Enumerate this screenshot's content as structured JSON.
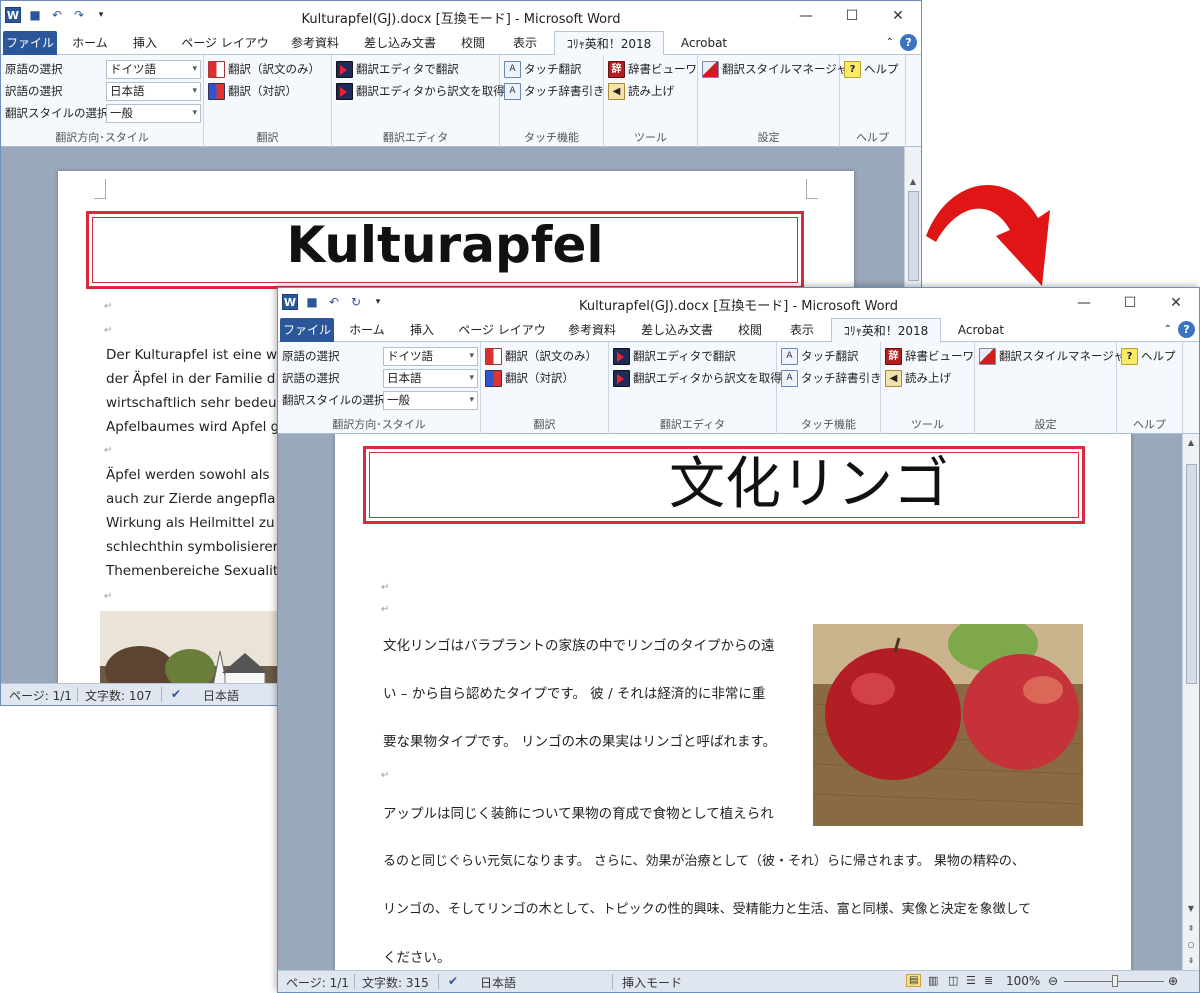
{
  "window_back": {
    "title": "Kulturapfel(GJ).docx [互換モード] - Microsoft Word",
    "tabs": [
      "ファイル",
      "ホーム",
      "挿入",
      "ページ レイアウト",
      "参考資料",
      "差し込み文書",
      "校閲",
      "表示",
      "ｺﾘｬ英和！2018",
      "Acrobat"
    ],
    "heading": "Kulturapfel",
    "paragraph_lines": [
      " Der Kulturapfel ist eine w",
      "der Äpfel in der Familie d",
      "wirtschaftlich sehr bedeu",
      "Apfelbaumes wird Apfel g"
    ],
    "paragraph2_lines": [
      "Äpfel werden sowohl als",
      "auch zur Zierde angepfla",
      "Wirkung als Heilmittel zu",
      "schlechthin symbolisierer",
      "Themenbereiche Sexualit"
    ],
    "status": {
      "page": "ページ: 1/1",
      "words": "文字数: 107",
      "lang": "日本語"
    }
  },
  "window_front": {
    "title": "Kulturapfel(GJ).docx [互換モード] - Microsoft Word",
    "tabs": [
      "ファイル",
      "ホーム",
      "挿入",
      "ページ レイアウト",
      "参考資料",
      "差し込み文書",
      "校閲",
      "表示",
      "ｺﾘｬ英和！2018",
      "Acrobat"
    ],
    "heading": "文化リンゴ",
    "paragraph_lines": [
      " 文化リンゴはバラプラントの家族の中でリンゴのタイプからの遠",
      "い – から自ら認めたタイプです。 彼 / それは経済的に非常に重",
      "要な果物タイプです。 リンゴの木の果実はリンゴと呼ばれます。"
    ],
    "paragraph2_lines": [
      "アップルは同じく装飾について果物の育成で食物として植えられ",
      "るのと同じぐらい元気になります。 さらに、効果が治療として（彼・それ）らに帰されます。 果物の精粋の、",
      "リンゴの、そしてリンゴの木として、トピックの性的興味、受精能力と生活、富と同様、実像と決定を象徴して",
      "ください。"
    ],
    "status": {
      "page": "ページ: 1/1",
      "words": "文字数: 315",
      "lang": "日本語",
      "mode": "挿入モード",
      "zoom": "100%"
    }
  },
  "ribbon": {
    "group_direction": {
      "label": "翻訳方向･スタイル",
      "source_label": "原語の選択",
      "source_value": "ドイツ語",
      "target_label": "訳語の選択",
      "target_value": "日本語",
      "style_label": "翻訳スタイルの選択",
      "style_value": "一般"
    },
    "group_translate": {
      "label": "翻訳",
      "btn1": "翻訳（訳文のみ）",
      "btn2": "翻訳（対訳）"
    },
    "group_editor": {
      "label": "翻訳エディタ",
      "btn1": "翻訳エディタで翻訳",
      "btn2": "翻訳エディタから訳文を取得"
    },
    "group_touch": {
      "label": "タッチ機能",
      "btn1": "タッチ翻訳",
      "btn2": "タッチ辞書引き"
    },
    "group_tools": {
      "label": "ツール",
      "btn1": "辞書ビューワ",
      "btn2": "読み上げ"
    },
    "group_settings": {
      "label": "設定",
      "btn1": "翻訳スタイルマネージャ"
    },
    "group_help": {
      "label": "ヘルプ",
      "btn1": "ヘルプ"
    }
  },
  "colors": {
    "accent": "#2b579a",
    "heading_border": "#d82c3c",
    "arrow": "#e01515"
  }
}
